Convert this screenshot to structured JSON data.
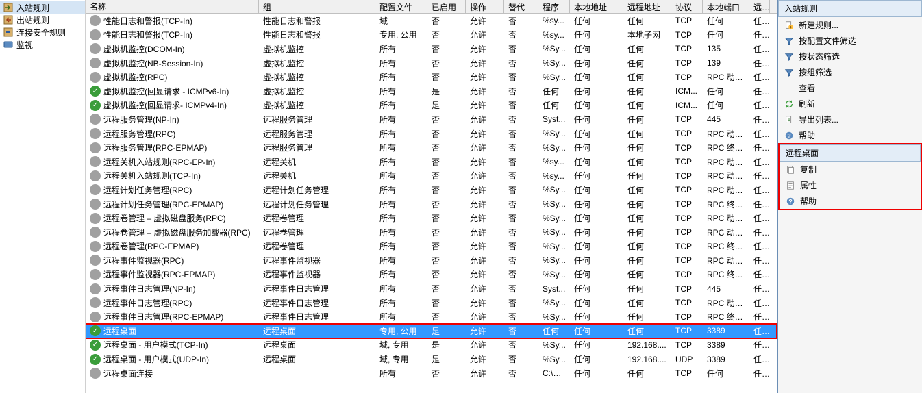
{
  "nav": [
    {
      "icon": "in",
      "label": "入站规则",
      "sel": true
    },
    {
      "icon": "out",
      "label": "出站规则"
    },
    {
      "icon": "sec",
      "label": "连接安全规则"
    },
    {
      "icon": "mon",
      "label": "监视"
    }
  ],
  "cols": [
    "名称",
    "组",
    "配置文件",
    "已启用",
    "操作",
    "替代",
    "程序",
    "本地地址",
    "远程地址",
    "协议",
    "本地端口",
    "远..."
  ],
  "rows": [
    {
      "en": false,
      "name": "性能日志和警报(TCP-In)",
      "grp": "性能日志和警报",
      "prof": "域",
      "on": "否",
      "act": "允许",
      "ov": "否",
      "prog": "%sy...",
      "la": "任何",
      "ra": "任何",
      "proto": "TCP",
      "lp": "任何",
      "rp": "任..."
    },
    {
      "en": false,
      "name": "性能日志和警报(TCP-In)",
      "grp": "性能日志和警报",
      "prof": "专用, 公用",
      "on": "否",
      "act": "允许",
      "ov": "否",
      "prog": "%sy...",
      "la": "任何",
      "ra": "本地子网",
      "proto": "TCP",
      "lp": "任何",
      "rp": "任..."
    },
    {
      "en": false,
      "name": "虚拟机监控(DCOM-In)",
      "grp": "虚拟机监控",
      "prof": "所有",
      "on": "否",
      "act": "允许",
      "ov": "否",
      "prog": "%Sy...",
      "la": "任何",
      "ra": "任何",
      "proto": "TCP",
      "lp": "135",
      "rp": "任..."
    },
    {
      "en": false,
      "name": "虚拟机监控(NB-Session-In)",
      "grp": "虚拟机监控",
      "prof": "所有",
      "on": "否",
      "act": "允许",
      "ov": "否",
      "prog": "%Sy...",
      "la": "任何",
      "ra": "任何",
      "proto": "TCP",
      "lp": "139",
      "rp": "任..."
    },
    {
      "en": false,
      "name": "虚拟机监控(RPC)",
      "grp": "虚拟机监控",
      "prof": "所有",
      "on": "否",
      "act": "允许",
      "ov": "否",
      "prog": "%Sy...",
      "la": "任何",
      "ra": "任何",
      "proto": "TCP",
      "lp": "RPC 动态...",
      "rp": "任..."
    },
    {
      "en": true,
      "name": "虚拟机监控(回显请求 - ICMPv6-In)",
      "grp": "虚拟机监控",
      "prof": "所有",
      "on": "是",
      "act": "允许",
      "ov": "否",
      "prog": "任何",
      "la": "任何",
      "ra": "任何",
      "proto": "ICM...",
      "lp": "任何",
      "rp": "任..."
    },
    {
      "en": true,
      "name": "虚拟机监控(回显请求- ICMPv4-In)",
      "grp": "虚拟机监控",
      "prof": "所有",
      "on": "是",
      "act": "允许",
      "ov": "否",
      "prog": "任何",
      "la": "任何",
      "ra": "任何",
      "proto": "ICM...",
      "lp": "任何",
      "rp": "任..."
    },
    {
      "en": false,
      "name": "远程服务管理(NP-In)",
      "grp": "远程服务管理",
      "prof": "所有",
      "on": "否",
      "act": "允许",
      "ov": "否",
      "prog": "Syst...",
      "la": "任何",
      "ra": "任何",
      "proto": "TCP",
      "lp": "445",
      "rp": "任..."
    },
    {
      "en": false,
      "name": "远程服务管理(RPC)",
      "grp": "远程服务管理",
      "prof": "所有",
      "on": "否",
      "act": "允许",
      "ov": "否",
      "prog": "%Sy...",
      "la": "任何",
      "ra": "任何",
      "proto": "TCP",
      "lp": "RPC 动态...",
      "rp": "任..."
    },
    {
      "en": false,
      "name": "远程服务管理(RPC-EPMAP)",
      "grp": "远程服务管理",
      "prof": "所有",
      "on": "否",
      "act": "允许",
      "ov": "否",
      "prog": "%Sy...",
      "la": "任何",
      "ra": "任何",
      "proto": "TCP",
      "lp": "RPC 终结...",
      "rp": "任..."
    },
    {
      "en": false,
      "name": "远程关机入站规则(RPC-EP-In)",
      "grp": "远程关机",
      "prof": "所有",
      "on": "否",
      "act": "允许",
      "ov": "否",
      "prog": "%sy...",
      "la": "任何",
      "ra": "任何",
      "proto": "TCP",
      "lp": "RPC 动态...",
      "rp": "任..."
    },
    {
      "en": false,
      "name": "远程关机入站规则(TCP-In)",
      "grp": "远程关机",
      "prof": "所有",
      "on": "否",
      "act": "允许",
      "ov": "否",
      "prog": "%sy...",
      "la": "任何",
      "ra": "任何",
      "proto": "TCP",
      "lp": "RPC 动态...",
      "rp": "任..."
    },
    {
      "en": false,
      "name": "远程计划任务管理(RPC)",
      "grp": "远程计划任务管理",
      "prof": "所有",
      "on": "否",
      "act": "允许",
      "ov": "否",
      "prog": "%Sy...",
      "la": "任何",
      "ra": "任何",
      "proto": "TCP",
      "lp": "RPC 动态...",
      "rp": "任..."
    },
    {
      "en": false,
      "name": "远程计划任务管理(RPC-EPMAP)",
      "grp": "远程计划任务管理",
      "prof": "所有",
      "on": "否",
      "act": "允许",
      "ov": "否",
      "prog": "%Sy...",
      "la": "任何",
      "ra": "任何",
      "proto": "TCP",
      "lp": "RPC 终结...",
      "rp": "任..."
    },
    {
      "en": false,
      "name": "远程卷管理 – 虚拟磁盘服务(RPC)",
      "grp": "远程卷管理",
      "prof": "所有",
      "on": "否",
      "act": "允许",
      "ov": "否",
      "prog": "%Sy...",
      "la": "任何",
      "ra": "任何",
      "proto": "TCP",
      "lp": "RPC 动态...",
      "rp": "任..."
    },
    {
      "en": false,
      "name": "远程卷管理 – 虚拟磁盘服务加载器(RPC)",
      "grp": "远程卷管理",
      "prof": "所有",
      "on": "否",
      "act": "允许",
      "ov": "否",
      "prog": "%Sy...",
      "la": "任何",
      "ra": "任何",
      "proto": "TCP",
      "lp": "RPC 动态...",
      "rp": "任..."
    },
    {
      "en": false,
      "name": "远程卷管理(RPC-EPMAP)",
      "grp": "远程卷管理",
      "prof": "所有",
      "on": "否",
      "act": "允许",
      "ov": "否",
      "prog": "%Sy...",
      "la": "任何",
      "ra": "任何",
      "proto": "TCP",
      "lp": "RPC 终结...",
      "rp": "任..."
    },
    {
      "en": false,
      "name": "远程事件监视器(RPC)",
      "grp": "远程事件监视器",
      "prof": "所有",
      "on": "否",
      "act": "允许",
      "ov": "否",
      "prog": "%Sy...",
      "la": "任何",
      "ra": "任何",
      "proto": "TCP",
      "lp": "RPC 动态...",
      "rp": "任..."
    },
    {
      "en": false,
      "name": "远程事件监视器(RPC-EPMAP)",
      "grp": "远程事件监视器",
      "prof": "所有",
      "on": "否",
      "act": "允许",
      "ov": "否",
      "prog": "%Sy...",
      "la": "任何",
      "ra": "任何",
      "proto": "TCP",
      "lp": "RPC 终结...",
      "rp": "任..."
    },
    {
      "en": false,
      "name": "远程事件日志管理(NP-In)",
      "grp": "远程事件日志管理",
      "prof": "所有",
      "on": "否",
      "act": "允许",
      "ov": "否",
      "prog": "Syst...",
      "la": "任何",
      "ra": "任何",
      "proto": "TCP",
      "lp": "445",
      "rp": "任..."
    },
    {
      "en": false,
      "name": "远程事件日志管理(RPC)",
      "grp": "远程事件日志管理",
      "prof": "所有",
      "on": "否",
      "act": "允许",
      "ov": "否",
      "prog": "%Sy...",
      "la": "任何",
      "ra": "任何",
      "proto": "TCP",
      "lp": "RPC 动态...",
      "rp": "任..."
    },
    {
      "en": false,
      "name": "远程事件日志管理(RPC-EPMAP)",
      "grp": "远程事件日志管理",
      "prof": "所有",
      "on": "否",
      "act": "允许",
      "ov": "否",
      "prog": "%Sy...",
      "la": "任何",
      "ra": "任何",
      "proto": "TCP",
      "lp": "RPC 终结...",
      "rp": "任..."
    },
    {
      "en": true,
      "name": "远程桌面",
      "grp": "远程桌面",
      "prof": "专用, 公用",
      "on": "是",
      "act": "允许",
      "ov": "否",
      "prog": "任何",
      "la": "任何",
      "ra": "任何",
      "proto": "TCP",
      "lp": "3389",
      "rp": "任...",
      "sel": true,
      "hl": true
    },
    {
      "en": true,
      "name": "远程桌面 - 用户模式(TCP-In)",
      "grp": "远程桌面",
      "prof": "域, 专用",
      "on": "是",
      "act": "允许",
      "ov": "否",
      "prog": "%Sy...",
      "la": "任何",
      "ra": "192.168....",
      "proto": "TCP",
      "lp": "3389",
      "rp": "任..."
    },
    {
      "en": true,
      "name": "远程桌面 - 用户模式(UDP-In)",
      "grp": "远程桌面",
      "prof": "域, 专用",
      "on": "是",
      "act": "允许",
      "ov": "否",
      "prog": "%Sy...",
      "la": "任何",
      "ra": "192.168....",
      "proto": "UDP",
      "lp": "3389",
      "rp": "任..."
    },
    {
      "en": false,
      "name": "远程桌面连接",
      "grp": "",
      "prof": "所有",
      "on": "否",
      "act": "允许",
      "ov": "否",
      "prog": "C:\\W...",
      "la": "任何",
      "ra": "任何",
      "proto": "TCP",
      "lp": "任何",
      "rp": "任..."
    }
  ],
  "side": {
    "title": "入站规则",
    "actions1": [
      {
        "icon": "new",
        "label": "新建规则..."
      },
      {
        "icon": "filter",
        "label": "按配置文件筛选"
      },
      {
        "icon": "filter",
        "label": "按状态筛选"
      },
      {
        "icon": "filter",
        "label": "按组筛选"
      },
      {
        "icon": "",
        "label": "查看"
      },
      {
        "icon": "refresh",
        "label": "刷新"
      },
      {
        "icon": "export",
        "label": "导出列表..."
      },
      {
        "icon": "help",
        "label": "帮助"
      }
    ],
    "title2": "远程桌面",
    "actions2": [
      {
        "icon": "copy",
        "label": "复制"
      },
      {
        "icon": "prop",
        "label": "属性"
      },
      {
        "icon": "help",
        "label": "帮助"
      }
    ]
  }
}
